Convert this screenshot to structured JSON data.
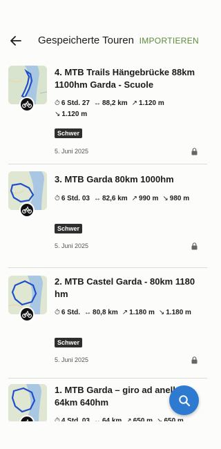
{
  "header": {
    "title": "Gespeicherte Touren",
    "import_label": "IMPORTIEREN"
  },
  "tours": [
    {
      "title": "4. MTB Trails Hängebrücke 88km 1100hm Garda - Scuole",
      "duration": "6 Std. 27",
      "distance": "88,2 km",
      "ascent": "1.120 m",
      "descent": "1.120 m",
      "difficulty": "Schwer",
      "date": "5. Juni 2025"
    },
    {
      "title": "3. MTB Garda 80km 1000hm",
      "duration": "6 Std. 03",
      "distance": "82,6 km",
      "ascent": "990 m",
      "descent": "980 m",
      "difficulty": "Schwer",
      "date": "5. Juni 2025"
    },
    {
      "title": "2. MTB Castel Garda - 80km 1180 hm",
      "duration": "6 Std.",
      "distance": "80,8 km",
      "ascent": "1.180 m",
      "descent": "1.180 m",
      "difficulty": "Schwer",
      "date": "5. Juni 2025"
    },
    {
      "title": "1. MTB Garda – giro ad anello 64km 640hm",
      "duration": "4 Std. 03",
      "distance": "64 km",
      "ascent": "650 m",
      "descent": "650 m"
    }
  ],
  "icons": {
    "back": "arrow-left-icon",
    "duration": "stopwatch-icon",
    "distance": "distance-arrows-icon",
    "ascent": "arrow-up-right-icon",
    "descent": "arrow-down-right-icon",
    "sport": "bicycle-icon",
    "private": "lock-icon",
    "search": "search-icon"
  },
  "colors": {
    "accent": "#5c8a3a",
    "fab": "#2f7ad1",
    "badge": "#2e2e2e"
  }
}
